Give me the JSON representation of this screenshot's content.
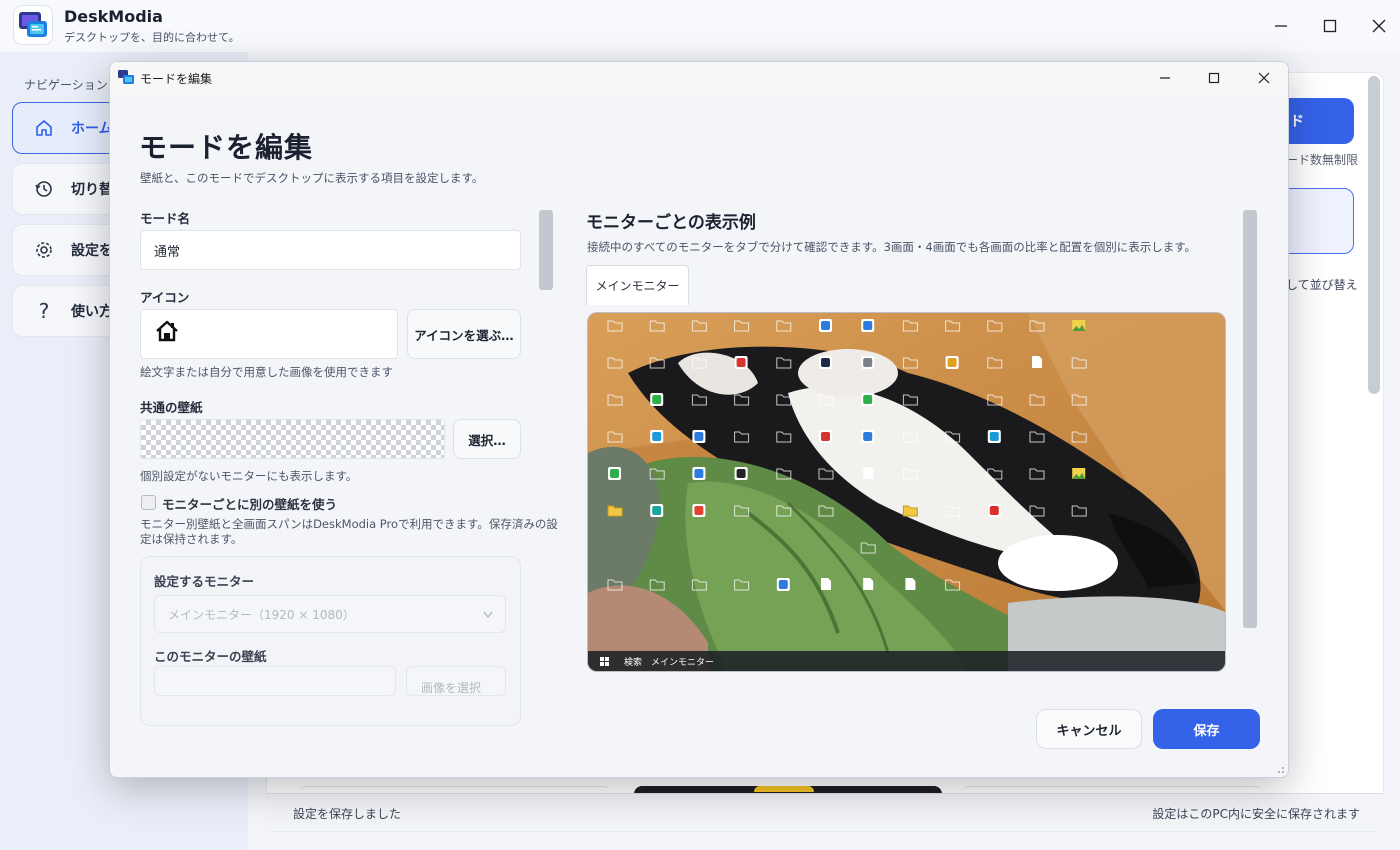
{
  "app": {
    "title": "DeskModia",
    "subtitle": "デスクトップを、目的に合わせて。",
    "brand_color": "#3463ea"
  },
  "sidebar": {
    "heading": "ナビゲーション",
    "items": [
      {
        "label": "ホーム",
        "icon": "home-icon",
        "active": true
      },
      {
        "label": "切り替",
        "icon": "history-icon",
        "active": false
      },
      {
        "label": "設定を",
        "icon": "gear-icon",
        "active": false
      },
      {
        "label": "使い方",
        "icon": "help-icon",
        "active": false
      }
    ]
  },
  "background": {
    "primary_button_fragment": "ド",
    "note1": "ード数無制限",
    "note2": "して並び替え"
  },
  "status": {
    "left": "設定を保存しました",
    "right": "設定はこのPC内に安全に保存されます"
  },
  "dialog": {
    "window_title": "モードを編集",
    "heading": "モードを編集",
    "description": "壁紙と、このモードでデスクトップに表示する項目を設定します。",
    "mode_name_label": "モード名",
    "mode_name_value": "通常",
    "icon_label": "アイコン",
    "icon_value": "🏠",
    "choose_icon_button": "アイコンを選ぶ…",
    "icon_help": "絵文字または自分で用意した画像を使用できます",
    "common_wallpaper_label": "共通の壁紙",
    "select_button": "選択…",
    "wallpaper_help": "個別設定がないモニターにも表示します。",
    "per_monitor_checkbox": "モニターごとに別の壁紙を使う",
    "per_monitor_checked": false,
    "pro_note_line1": "モニター別壁紙と全画面スパンはDeskModia Proで利用できます。保存済みの設",
    "pro_note_line2": "定は保持されます。",
    "target_monitor_label": "設定するモニター",
    "target_monitor_value": "メインモニター（1920 × 1080）",
    "monitor_wallpaper_label": "このモニターの壁紙",
    "monitor_wallpaper_button": "画像を選択",
    "preview_title": "モニターごとの表示例",
    "preview_desc": "接続中のすべてのモニターをタブで分けて確認できます。3画面・4画面でも各画面の比率と配置を個別に表示します。",
    "preview_tab": "メインモニター",
    "taskbar_search": "検索",
    "taskbar_monitor": "メインモニター",
    "cancel_button": "キャンセル",
    "save_button": "保存"
  },
  "preview_icons": {
    "rows": [
      [
        "folder",
        "folder",
        "folder",
        "folder",
        "folder",
        "app-blue",
        "app-blue",
        "folder",
        "folder",
        "folder",
        "folder",
        "image"
      ],
      [
        "folder",
        "folder",
        "folder",
        "app-red",
        "folder",
        "app-chat",
        "app-grid",
        "folder",
        "app-color",
        "folder",
        "doc",
        "folder"
      ],
      [
        "folder",
        "app-green",
        "folder",
        "folder",
        "folder",
        "folder",
        "app-green",
        "folder",
        "",
        "folder",
        "folder",
        "folder"
      ],
      [
        "folder",
        "app-edge",
        "app-blue",
        "folder",
        "folder",
        "app-red",
        "app-blue",
        "folder",
        "folder",
        "app-edge",
        "folder",
        "folder"
      ],
      [
        "app-green",
        "folder",
        "app-blue",
        "app-dark",
        "folder",
        "folder",
        "doc",
        "folder",
        "",
        "folder",
        "folder",
        "image"
      ],
      [
        "folder-yellow",
        "app-teal",
        "app-chrome",
        "folder",
        "folder",
        "folder",
        "",
        "folder-yellow",
        "folder",
        "app-pdf",
        "folder",
        "folder"
      ],
      [
        "",
        "",
        "",
        "",
        "",
        "",
        "folder",
        "",
        "",
        "",
        "",
        ""
      ],
      [
        "folder",
        "folder",
        "folder",
        "folder",
        "app-blue",
        "doc",
        "doc",
        "doc",
        "folder",
        "",
        "",
        ""
      ]
    ]
  }
}
